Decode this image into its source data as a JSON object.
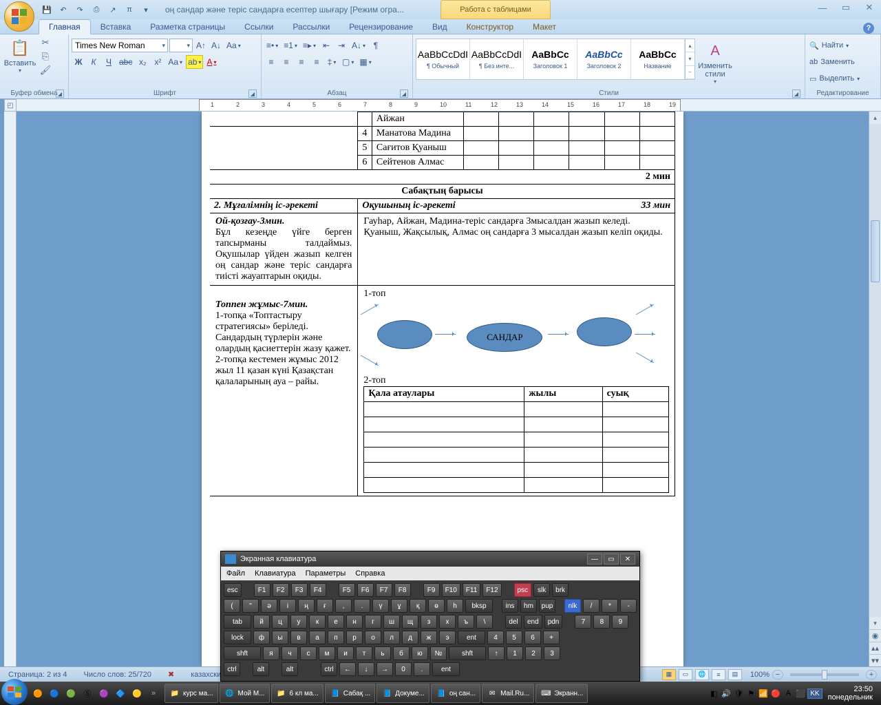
{
  "title": "оң сандар және теріс сандарға есептер шығару [Режим огра...",
  "context_tab": "Работа с таблицами",
  "tabs": [
    "Главная",
    "Вставка",
    "Разметка страницы",
    "Ссылки",
    "Рассылки",
    "Рецензирование",
    "Вид",
    "Конструктор",
    "Макет"
  ],
  "ribbon": {
    "clipboard": {
      "label": "Буфер обмена",
      "paste": "Вставить"
    },
    "font": {
      "label": "Шрифт",
      "name": "Times New Roman",
      "size": ""
    },
    "para": {
      "label": "Абзац"
    },
    "styles": {
      "label": "Стили",
      "items": [
        {
          "preview": "AaBbCcDdI",
          "name": "¶ Обычный"
        },
        {
          "preview": "AaBbCcDdI",
          "name": "¶ Без инте..."
        },
        {
          "preview": "AaBbCc",
          "name": "Заголовок 1",
          "bold": true
        },
        {
          "preview": "AaBbCc",
          "name": "Заголовок 2",
          "italic": true
        },
        {
          "preview": "AaBbCc",
          "name": "Название",
          "bold": true
        }
      ],
      "change": "Изменить стили"
    },
    "editing": {
      "label": "Редактирование",
      "find": "Найти",
      "replace": "Заменить",
      "select": "Выделить"
    }
  },
  "doc": {
    "tbl_rows": [
      {
        "n": "",
        "name": "Айжан"
      },
      {
        "n": "4",
        "name": "Манатова Мадина"
      },
      {
        "n": "5",
        "name": "Сағитов Қуаныш"
      },
      {
        "n": "6",
        "name": "Сейтенов Алмас"
      }
    ],
    "time1": "2 мин",
    "heading": "Сабақтың барысы",
    "row2_left": "2. Мұғалімнің іс-әрекеті",
    "row2_mid": "Оқушының іс-әрекеті",
    "row2_time": "33  мин",
    "sec1_title": "Ой-қозғау-3мин.",
    "sec1_left": "Бұл кезеңде үйге берген тапсырманы талдаймыз. Оқушылар үйден жазып келген оң сандар және теріс сандарға тиісті жауаптарын оқиды.",
    "sec1_right": "Гауһар, Айжан, Мадина-теріс сандарға 3мысалдан жазып келеді.\nҚуаныш, Жақсылық, Алмас оң сандарға 3 мысалдан жазып келіп оқиды.",
    "sec2_title": "Топпен жұмыс-7мин.",
    "sec2_left": "1-топқа «Топтастыру стратегиясы» беріледі. Сандардың түрлерін және олардың қасиеттерін жазу қажет.\n2-топқа кестемен жұмыс 2012 жыл 11 қазан күні Қазақстан қалаларының ауа – райы.",
    "grp1": "1-топ",
    "center_word": "САНДАР",
    "grp2": "2-топ",
    "tbl2_h": [
      "Қала атаулары",
      "жылы",
      "суық"
    ]
  },
  "osk": {
    "title": "Экранная клавиатура",
    "menu": [
      "Файл",
      "Клавиатура",
      "Параметры",
      "Справка"
    ],
    "r1": [
      "esc",
      "F1",
      "F2",
      "F3",
      "F4",
      "F5",
      "F6",
      "F7",
      "F8",
      "F9",
      "F10",
      "F11",
      "F12",
      "psc",
      "slk",
      "brk"
    ],
    "r2": [
      "(",
      "\"",
      "ә",
      "і",
      "ң",
      "ғ",
      ",",
      ".",
      "ү",
      "ұ",
      "қ",
      "ө",
      "һ",
      "bksp",
      "ins",
      "hm",
      "pup",
      "nlk",
      "/",
      "*",
      "-"
    ],
    "r3": [
      "tab",
      "й",
      "ц",
      "у",
      "к",
      "е",
      "н",
      "г",
      "ш",
      "щ",
      "з",
      "х",
      "ъ",
      "\\",
      "del",
      "end",
      "pdn",
      "7",
      "8",
      "9"
    ],
    "r4": [
      "lock",
      "ф",
      "ы",
      "в",
      "а",
      "п",
      "р",
      "о",
      "л",
      "д",
      "ж",
      "э",
      "ent",
      "4",
      "5",
      "6",
      "+"
    ],
    "r5": [
      "shft",
      "я",
      "ч",
      "с",
      "м",
      "и",
      "т",
      "ь",
      "б",
      "ю",
      "№",
      "shft",
      "↑",
      "1",
      "2",
      "3"
    ],
    "r6": [
      "ctrl",
      "",
      "alt",
      "",
      "alt",
      "",
      "",
      "ctrl",
      "←",
      "↓",
      "→",
      "0",
      ".",
      "ent"
    ]
  },
  "status": {
    "page": "Страница: 2 из 4",
    "words": "Число слов: 25/720",
    "lang": "казахский",
    "zoom": "100%"
  },
  "taskbar": {
    "items": [
      "курс ма...",
      "Мой М...",
      "6 кл ма...",
      "Сабақ ...",
      "Докуме...",
      "оң сан...",
      "Mail.Ru...",
      "Экранн..."
    ],
    "lang": "KK",
    "time": "23:50",
    "day": "понедельник"
  }
}
